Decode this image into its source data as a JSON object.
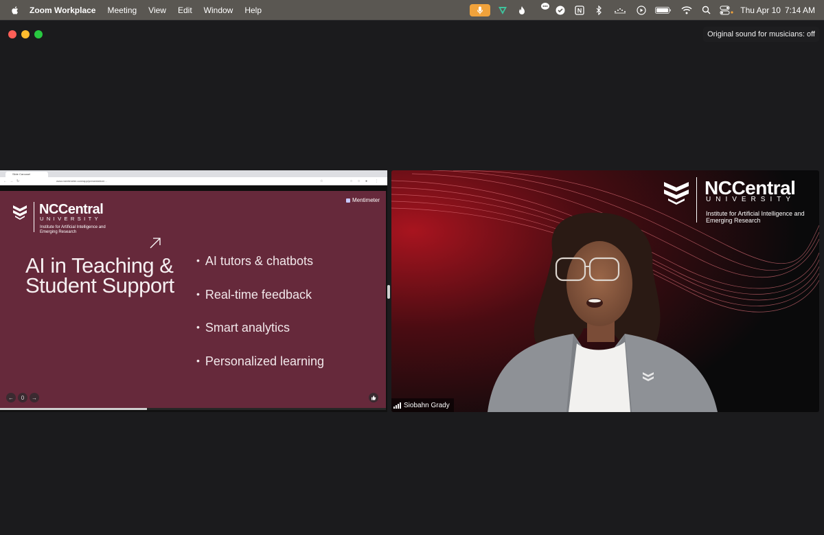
{
  "menubar": {
    "app_name": "Zoom Workplace",
    "menus": [
      "Meeting",
      "View",
      "Edit",
      "Window",
      "Help"
    ],
    "status_icons": [
      "microphone-icon",
      "vpn-icon",
      "flame-icon",
      "chat-bubble-icon",
      "checkmark-icon",
      "notion-icon",
      "bluetooth-icon",
      "dots-icon",
      "play-icon",
      "battery-icon",
      "wifi-icon",
      "search-icon",
      "control-center-icon"
    ],
    "date": "Thu Apr 10",
    "time": "7:14 AM",
    "mic_color": "#f0a23b"
  },
  "window": {
    "original_sound": "Original sound for musicians: off"
  },
  "shared_screen": {
    "browser_tab_label": "Slide Carousel",
    "browser_url": "www.mentimeter.com/app/presentation/…",
    "slide": {
      "bg_color": "#66293b",
      "logo_name": "NCCentral",
      "logo_univ": "UNIVERSITY",
      "logo_inst": "Institute for Artificial Intelligence and Emerging Research",
      "provider": "Mentimeter",
      "title": "AI in Teaching & Student Support",
      "bullets": [
        "AI tutors & chatbots",
        "Real-time feedback",
        "Smart analytics",
        "Personalized learning"
      ],
      "page_label": "0",
      "progress_fraction": 0.38
    }
  },
  "video": {
    "logo_name": "NCCentral",
    "logo_univ": "UNIVERSITY",
    "logo_inst": "Institute for Artificial Intelligence and Emerging Research",
    "participant_name": "Siobahn Grady"
  }
}
